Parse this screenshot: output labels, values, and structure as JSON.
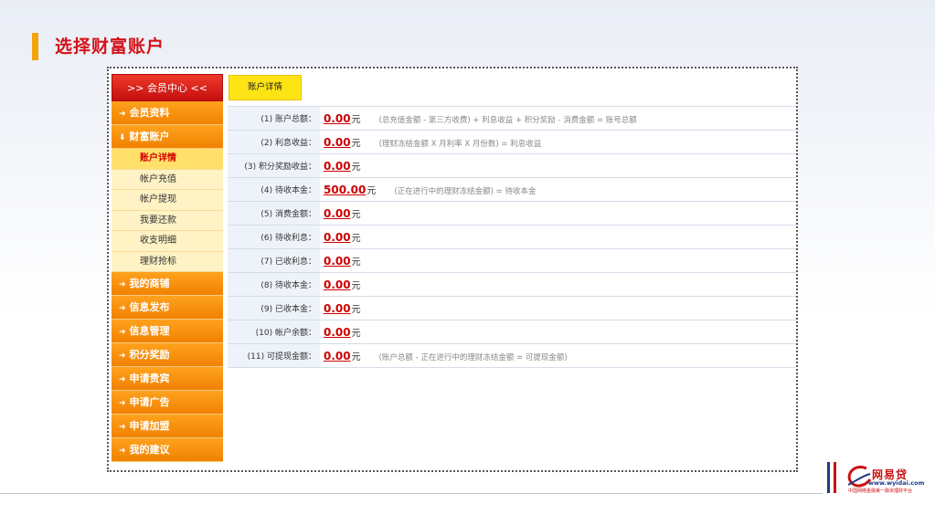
{
  "page": {
    "title": "选择财富账户"
  },
  "sidebar": {
    "header": ">> 会员中心 <<",
    "items": [
      {
        "icon": "arrow-right-icon",
        "label": "会员资料"
      },
      {
        "icon": "arrow-down-icon",
        "label": "财富账户"
      }
    ],
    "sub_items": [
      {
        "label": "账户详情",
        "active": true
      },
      {
        "label": "帐户充值"
      },
      {
        "label": "帐户提现"
      },
      {
        "label": "我要还款"
      },
      {
        "label": "收支明细"
      },
      {
        "label": "理财抢标"
      }
    ],
    "more_items": [
      {
        "label": "我的商铺"
      },
      {
        "label": "信息发布"
      },
      {
        "label": "信息管理"
      },
      {
        "label": "积分奖励"
      },
      {
        "label": "申请贵宾"
      },
      {
        "label": "申请广告"
      },
      {
        "label": "申请加盟"
      },
      {
        "label": "我的建议"
      }
    ]
  },
  "content": {
    "tab": "账户详情",
    "rows": [
      {
        "label": "(1) 账户总额：",
        "amount": "0.00",
        "unit": "元",
        "note": "(总充值金额 - 第三方收费) + 利息收益 + 积分奖励 - 消费金额 = 账号总额"
      },
      {
        "label": "(2) 利息收益：",
        "amount": "0.00",
        "unit": "元",
        "note": "(理财冻结金额 X 月利率 X 月份数) = 利息收益"
      },
      {
        "label": "(3) 积分奖励收益：",
        "amount": "0.00",
        "unit": "元",
        "note": ""
      },
      {
        "label": "(4) 待收本金：",
        "amount": "500.00",
        "unit": "元",
        "note": "(正在进行中的理财冻结金额) = 待收本金"
      },
      {
        "label": "(5) 消费金额：",
        "amount": "0.00",
        "unit": "元",
        "note": ""
      },
      {
        "label": "(6) 待收利息：",
        "amount": "0.00",
        "unit": "元",
        "note": ""
      },
      {
        "label": "(7) 已收利息：",
        "amount": "0.00",
        "unit": "元",
        "note": ""
      },
      {
        "label": "(8) 待收本金：",
        "amount": "0.00",
        "unit": "元",
        "note": ""
      },
      {
        "label": "(9) 已收本金：",
        "amount": "0.00",
        "unit": "元",
        "note": ""
      },
      {
        "label": "(10) 帐户余额：",
        "amount": "0.00",
        "unit": "元",
        "note": ""
      },
      {
        "label": "(11) 可提现金额：",
        "amount": "0.00",
        "unit": "元",
        "note": "(账户总额 - 正在进行中的理财冻结金额 = 可提现金额)"
      }
    ]
  },
  "logo": {
    "name": "网易贷",
    "url": "www.wyidai.com",
    "slogan": "中国网络金融第一融资理财平台"
  },
  "colors": {
    "title_red": "#d3121a",
    "menu_orange": "#f7920c",
    "header_red": "#d21b14",
    "tab_yellow": "#ffe415",
    "amount_red": "#cc0000"
  }
}
